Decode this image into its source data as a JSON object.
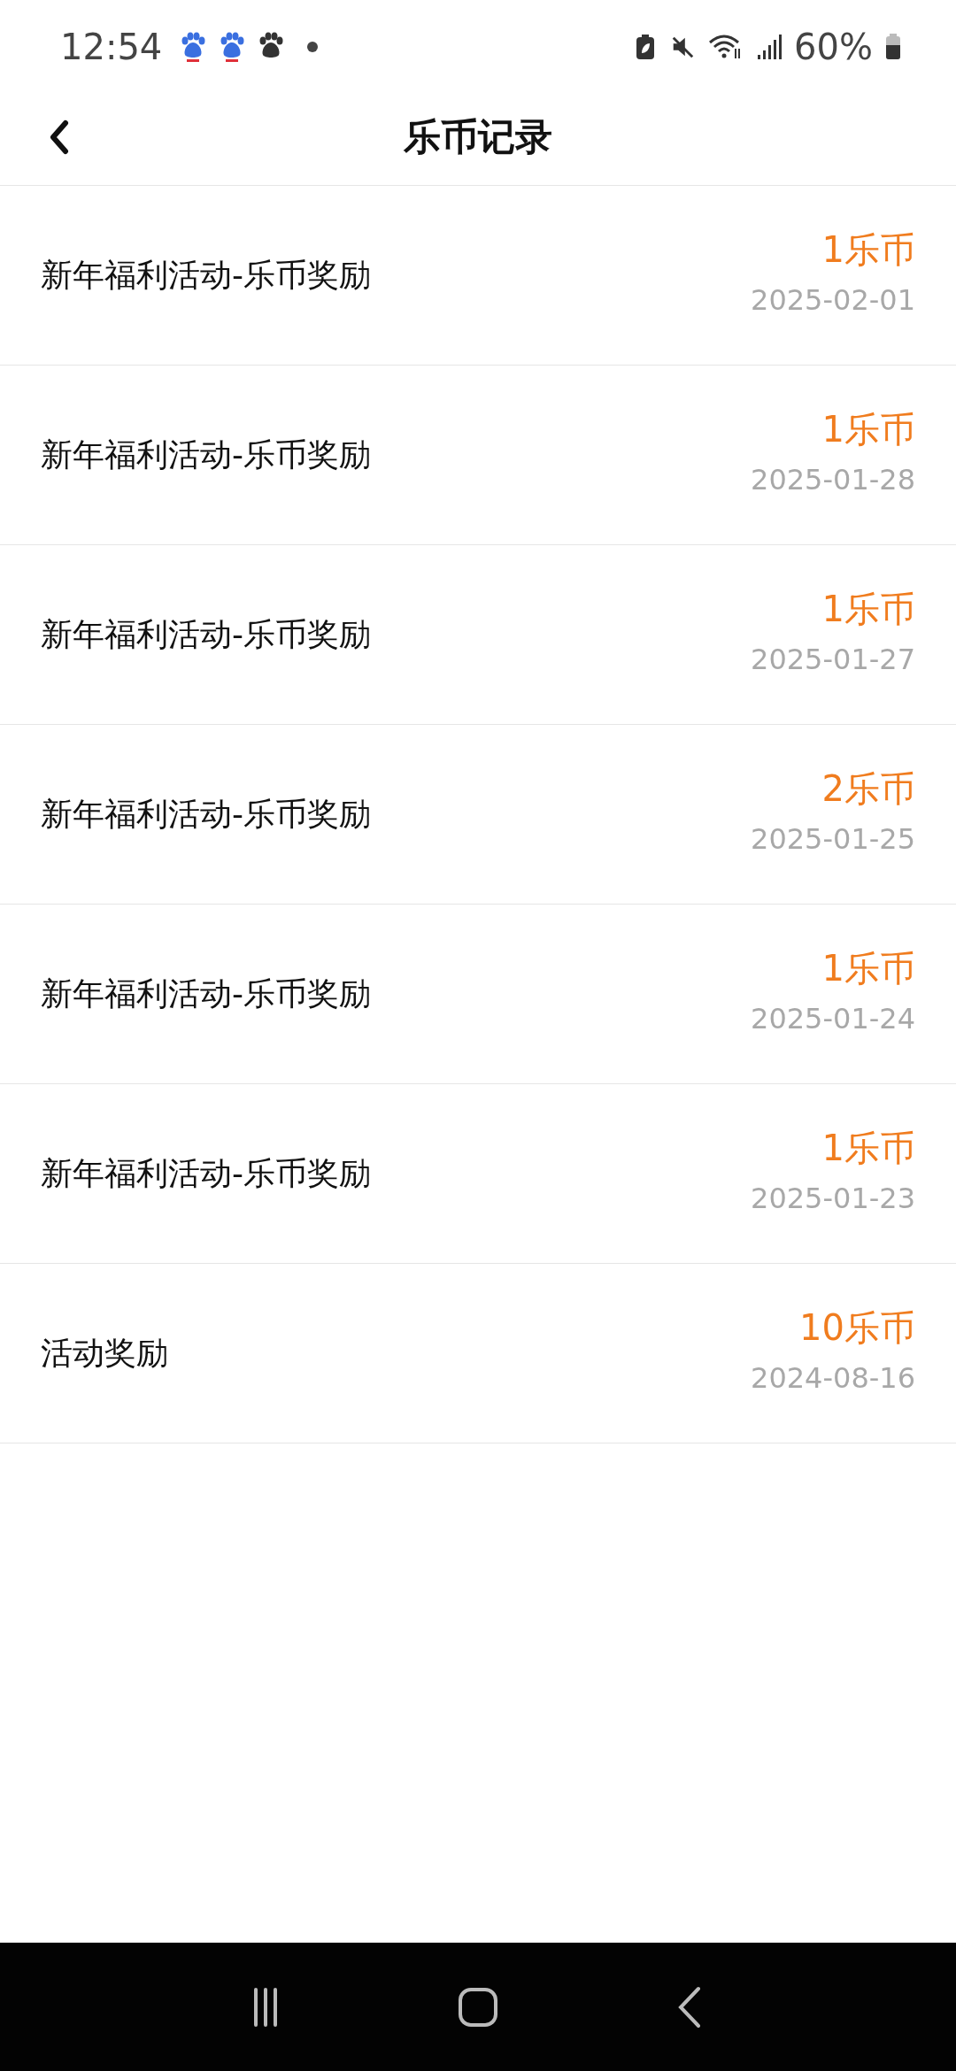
{
  "status_bar": {
    "time": "12:54",
    "battery": "60%"
  },
  "header": {
    "title": "乐币记录"
  },
  "records": [
    {
      "title": "新年福利活动-乐币奖励",
      "amount": "1乐币",
      "date": "2025-02-01"
    },
    {
      "title": "新年福利活动-乐币奖励",
      "amount": "1乐币",
      "date": "2025-01-28"
    },
    {
      "title": "新年福利活动-乐币奖励",
      "amount": "1乐币",
      "date": "2025-01-27"
    },
    {
      "title": "新年福利活动-乐币奖励",
      "amount": "2乐币",
      "date": "2025-01-25"
    },
    {
      "title": "新年福利活动-乐币奖励",
      "amount": "1乐币",
      "date": "2025-01-24"
    },
    {
      "title": "新年福利活动-乐币奖励",
      "amount": "1乐币",
      "date": "2025-01-23"
    },
    {
      "title": "活动奖励",
      "amount": "10乐币",
      "date": "2024-08-16"
    }
  ]
}
